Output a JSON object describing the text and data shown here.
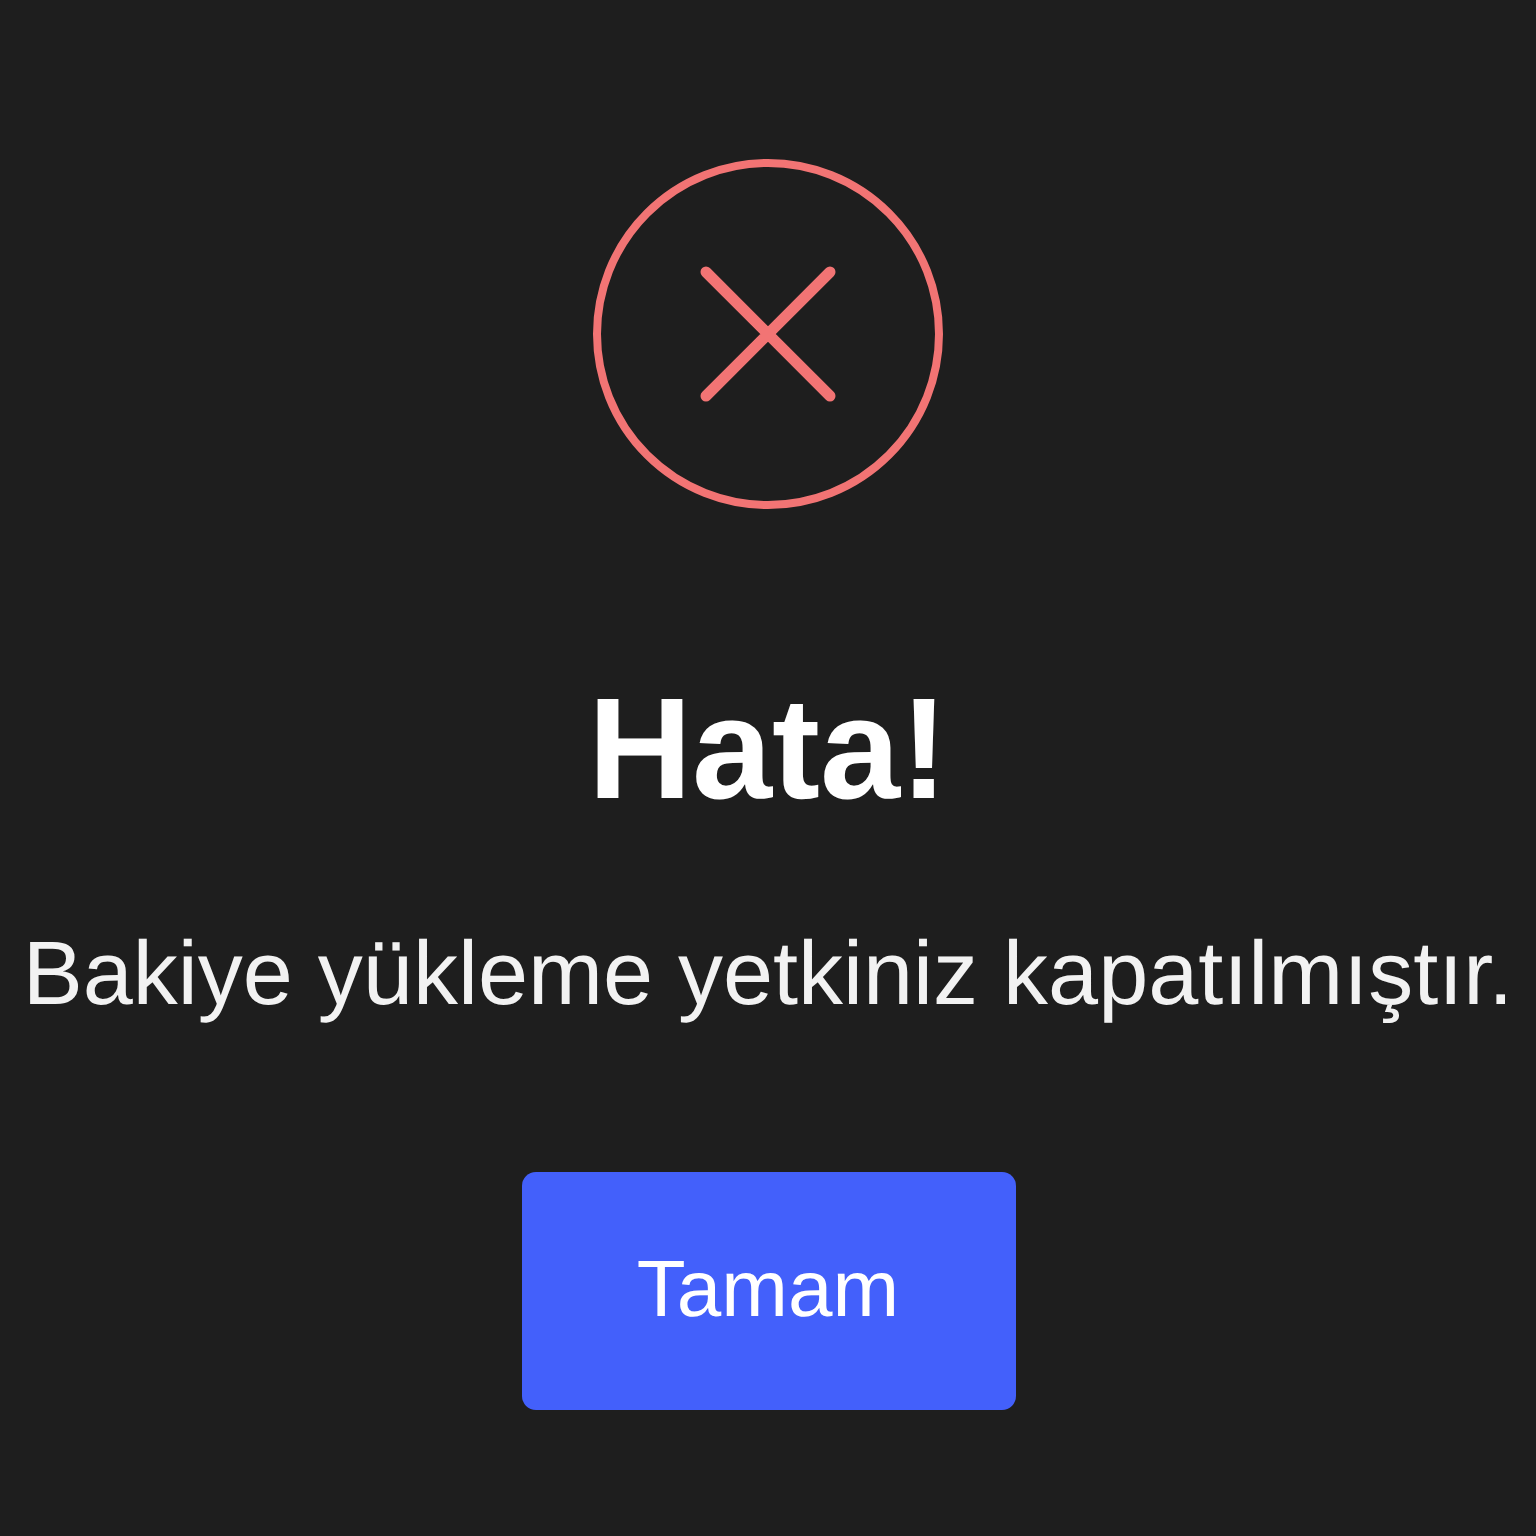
{
  "dialog": {
    "title": "Hata!",
    "message": "Bakiye yükleme yetkiniz kapatılmıştır.",
    "buttons": [
      {
        "label": "Tamam"
      }
    ]
  }
}
